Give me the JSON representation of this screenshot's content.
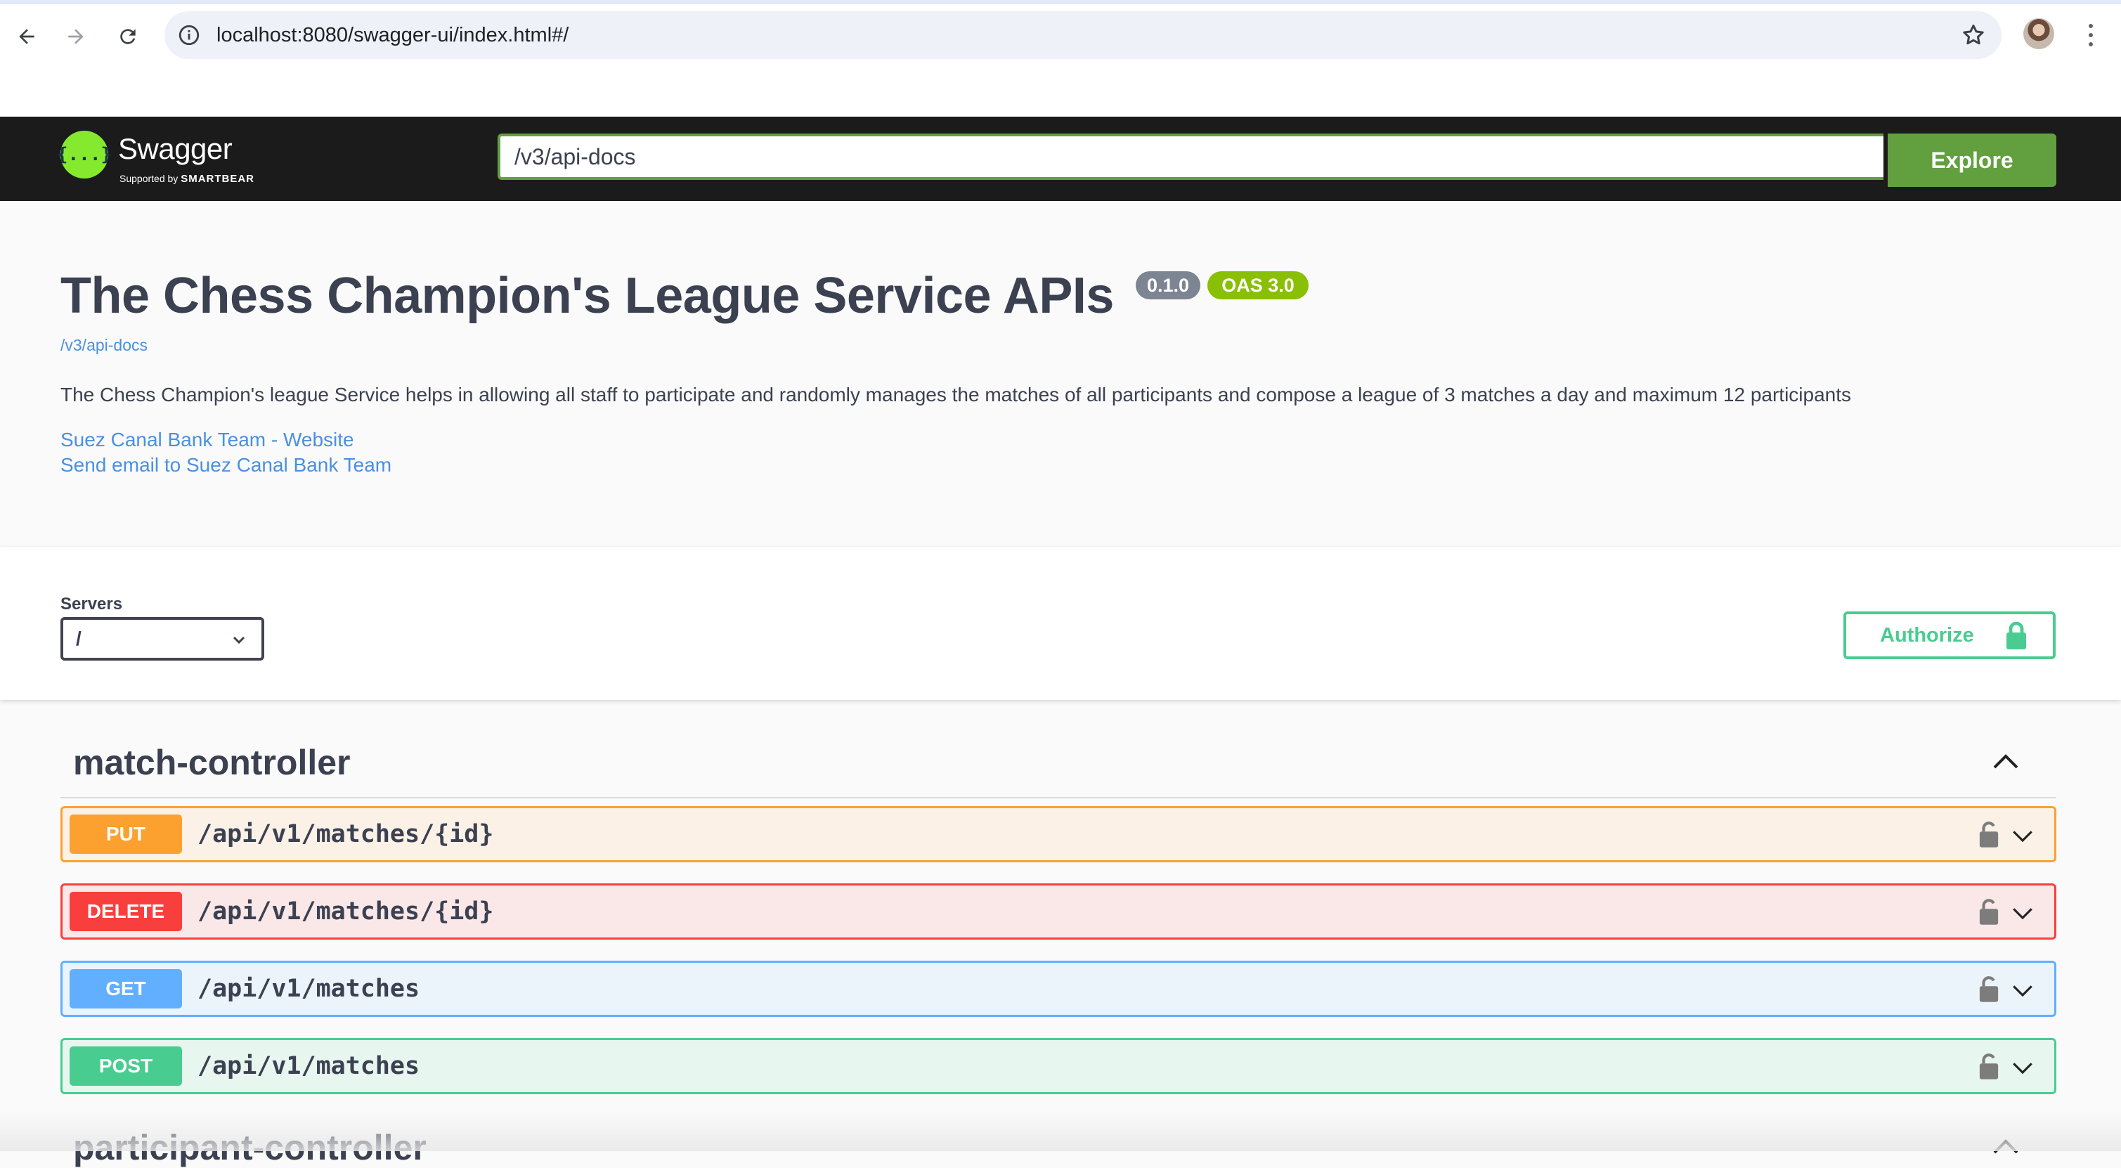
{
  "browser": {
    "url": "localhost:8080/swagger-ui/index.html#/"
  },
  "topbar": {
    "logo_name": "Swagger",
    "logo_glyph": "{...}",
    "logo_supported": "Supported by",
    "logo_brand": "SMARTBEAR",
    "spec_url_value": "/v3/api-docs",
    "explore_label": "Explore"
  },
  "info": {
    "title": "The Chess Champion's League Service APIs",
    "version_badge": "0.1.0",
    "oas_badge": "OAS 3.0",
    "spec_link": "/v3/api-docs",
    "description": "The Chess Champion's league Service helps in allowing all staff to participate and randomly manages the matches of all participants and compose a league of 3 matches a day and maximum 12 participants",
    "links": [
      "Suez Canal Bank Team - Website",
      "Send email to Suez Canal Bank Team"
    ]
  },
  "servers": {
    "label": "Servers",
    "selected": "/"
  },
  "authorize": {
    "label": "Authorize"
  },
  "tags": [
    {
      "name": "match-controller",
      "operations": [
        {
          "method": "PUT",
          "path": "/api/v1/matches/{id}"
        },
        {
          "method": "DELETE",
          "path": "/api/v1/matches/{id}"
        },
        {
          "method": "GET",
          "path": "/api/v1/matches"
        },
        {
          "method": "POST",
          "path": "/api/v1/matches"
        }
      ]
    },
    {
      "name": "participant-controller"
    }
  ],
  "colors": {
    "put": "#fca130",
    "delete": "#f93e3e",
    "get": "#61affe",
    "post": "#49cc90",
    "explore": "#62a03f",
    "authorize": "#49cc90",
    "link": "#4990e2"
  }
}
